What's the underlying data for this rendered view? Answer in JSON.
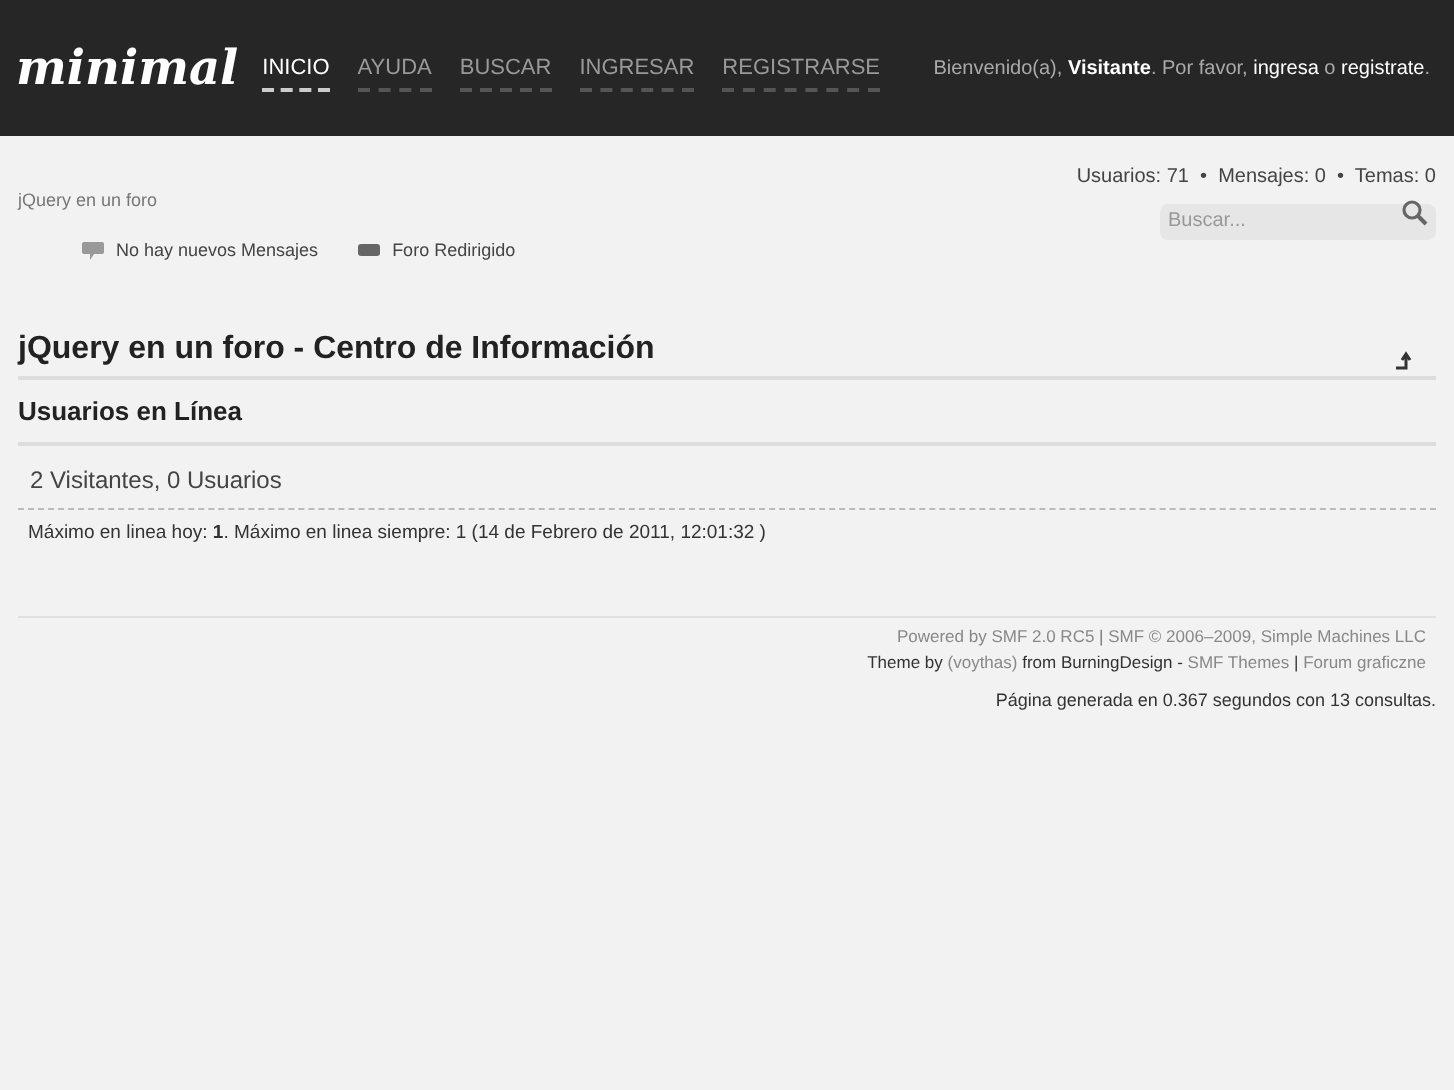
{
  "header": {
    "logo": "minimal",
    "nav": [
      {
        "label": "INICIO",
        "selected": true
      },
      {
        "label": "AYUDA",
        "selected": false
      },
      {
        "label": "BUSCAR",
        "selected": false
      },
      {
        "label": "INGRESAR",
        "selected": false
      },
      {
        "label": "REGISTRARSE",
        "selected": false
      }
    ],
    "welcome": [
      {
        "text": "Bienvenido(a), ",
        "kind": "text"
      },
      {
        "text": "Visitante",
        "kind": "bold"
      },
      {
        "text": ". Por favor, ",
        "kind": "text"
      },
      {
        "text": "ingresa",
        "kind": "link"
      },
      {
        "text": " o ",
        "kind": "text"
      },
      {
        "text": "registrate",
        "kind": "link"
      },
      {
        "text": ".",
        "kind": "text"
      }
    ]
  },
  "breadcrumb": "jQuery en un foro",
  "stats": "Usuarios: 71  •  Mensajes: 0  •  Temas: 0",
  "search": {
    "placeholder": "Buscar..."
  },
  "legend": [
    "No hay nuevos Mensajes",
    "Foro Redirigido"
  ],
  "title": "jQuery en un foro - Centro de Información",
  "section": "Usuarios en Línea",
  "online": "2 Visitantes, 0 Usuarios",
  "record": "Máximo en linea hoy: **1**. Máximo en linea siempre: 1 (14 de Febrero de 2011, 12:01:32 )",
  "footer": [
    [
      {
        "text": "Powered by SMF 2.0 RC5",
        "kind": "link"
      },
      {
        "text": " | ",
        "kind": "text"
      },
      {
        "text": "SMF © 2006–2009, Simple Machines LLC",
        "kind": "link"
      }
    ],
    [
      {
        "text": "Theme by ",
        "kind": "text"
      },
      {
        "text": "(voythas)",
        "kind": "link"
      },
      {
        "text": " from BurningDesign - ",
        "kind": "text"
      },
      {
        "text": "SMF Themes",
        "kind": "link"
      },
      {
        "text": " | ",
        "kind": "text"
      },
      {
        "text": "Forum graficzne",
        "kind": "link"
      }
    ]
  ],
  "generated": "Página generada en 0.367 segundos con 13 consultas."
}
